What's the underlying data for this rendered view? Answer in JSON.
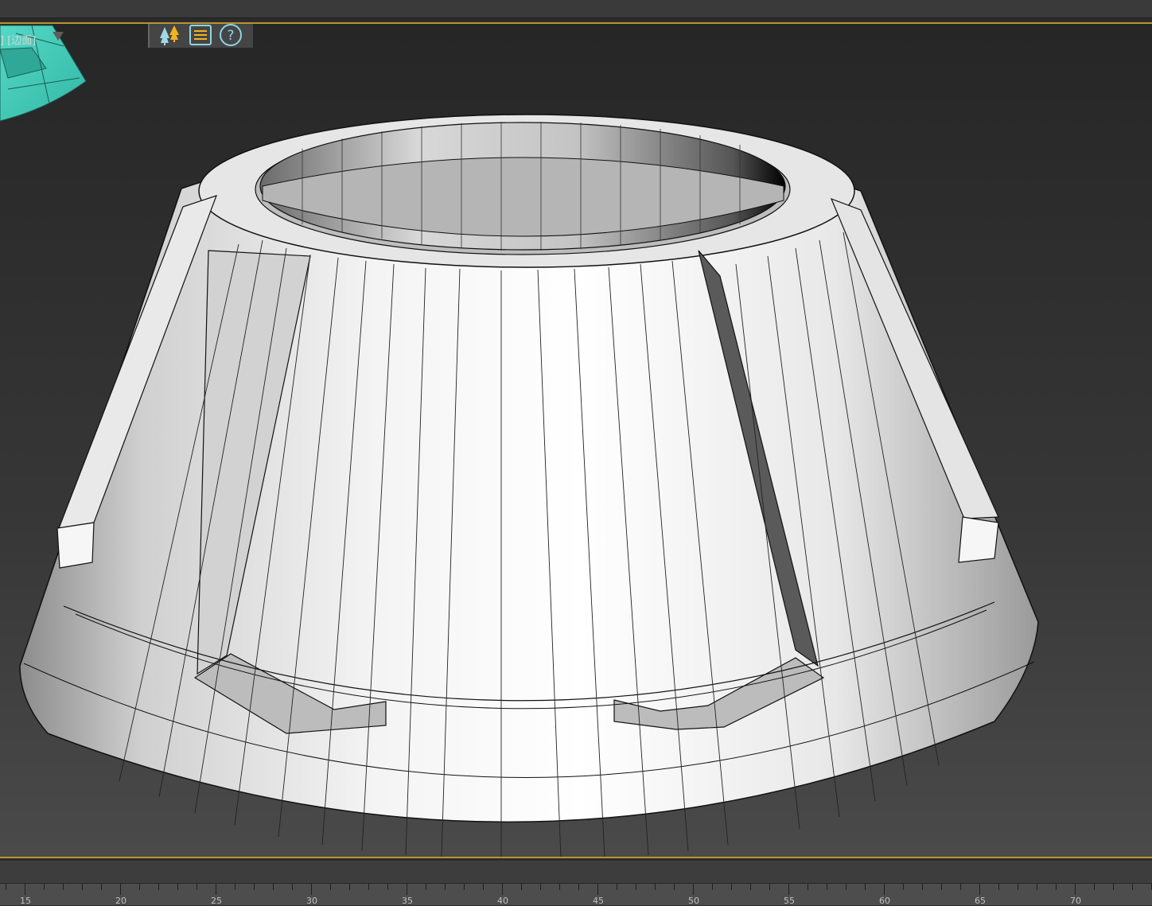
{
  "viewport": {
    "label": "] [边面]",
    "toolbar": {
      "scene_explorer_icon": "trees-icon",
      "menu_icon": "list-menu-icon",
      "help_icon": "question-icon"
    },
    "colors": {
      "frame_border": "#b89532",
      "selected_object": "#3ec7b4",
      "mesh": "#f2f2f2"
    }
  },
  "timeline": {
    "labels": [
      "15",
      "20",
      "25",
      "30",
      "35",
      "40",
      "45",
      "50",
      "55",
      "60",
      "65",
      "70"
    ]
  }
}
